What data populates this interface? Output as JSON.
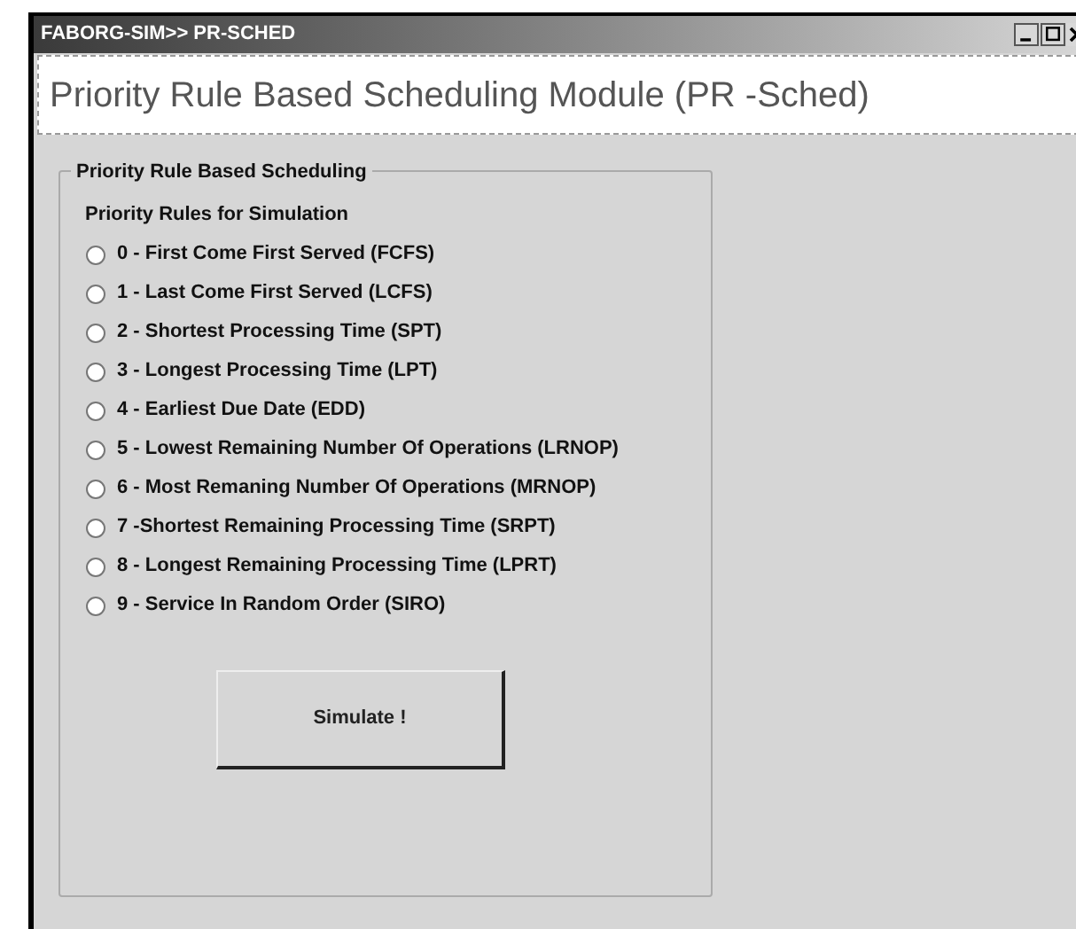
{
  "window": {
    "title": "FABORG-SIM>> PR-SCHED"
  },
  "header": {
    "title": "Priority Rule Based Scheduling Module (PR -Sched)"
  },
  "group": {
    "title": "Priority Rule Based Scheduling",
    "subtitle": "Priority Rules for Simulation",
    "options": [
      {
        "label": "0 - First Come First Served (FCFS)",
        "selected": false
      },
      {
        "label": "1 - Last Come First Served (LCFS)",
        "selected": false
      },
      {
        "label": "2 - Shortest Processing Time (SPT)",
        "selected": false
      },
      {
        "label": "3 - Longest Processing Time (LPT)",
        "selected": false
      },
      {
        "label": "4 - Earliest Due Date (EDD)",
        "selected": false
      },
      {
        "label": "5 - Lowest Remaining Number Of Operations (LRNOP)",
        "selected": false
      },
      {
        "label": "6 - Most Remaning Number Of Operations (MRNOP)",
        "selected": false
      },
      {
        "label": "7 -Shortest Remaining Processing Time (SRPT)",
        "selected": false
      },
      {
        "label": "8 - Longest Remaining Processing Time (LPRT)",
        "selected": false
      },
      {
        "label": "9 - Service In Random Order (SIRO)",
        "selected": false
      }
    ],
    "button": "Simulate !"
  }
}
